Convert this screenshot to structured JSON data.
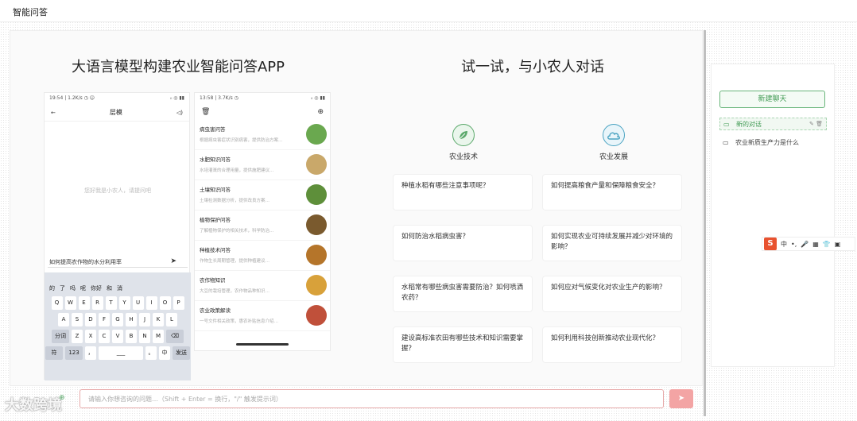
{
  "app": {
    "title": "智能问答"
  },
  "left_title": "大语言模型构建农业智能问答APP",
  "right_title": "试一试，与小农人对话",
  "phone1": {
    "status_time": "19:54 | 1.2K/s ◷ ☺",
    "status_right": "ᵢₗ ◎ ▮▮",
    "back_icon": "←",
    "title": "层模",
    "sound_icon": "◁)",
    "empty_text": "您好我是小农人，请提问吧",
    "input_value": "如何提高农作物的水分利用率",
    "send_icon": "➤",
    "candidates": [
      "的",
      "了",
      "吗",
      "呢",
      "你好",
      "和",
      "消"
    ],
    "keys_row1": [
      "Q",
      "W",
      "E",
      "R",
      "T",
      "Y",
      "U",
      "I",
      "O",
      "P"
    ],
    "keys_row2": [
      "A",
      "S",
      "D",
      "F",
      "G",
      "H",
      "J",
      "K",
      "L"
    ],
    "keys_row3": [
      "分词",
      "Z",
      "X",
      "C",
      "V",
      "B",
      "N",
      "M",
      "⌫"
    ],
    "keys_row4": [
      "符",
      "123",
      "，",
      "___",
      "。",
      "中",
      "发送"
    ]
  },
  "phone2": {
    "status_time": "13:58 | 3.7K/s ◷",
    "status_right": "ᵢₗ ◎ ▮▮",
    "trash_icon": "🗑",
    "add_icon": "⊕",
    "items": [
      {
        "title": "病虫害问答",
        "desc": "根据病虫害症状识别病害，提供防治方案…"
      },
      {
        "title": "水肥知识问答",
        "desc": "水培灌溉的合理用量，提供施肥建议…"
      },
      {
        "title": "土壤知识问答",
        "desc": "土壤检测数据分析，提供改良方案…"
      },
      {
        "title": "植物保护问答",
        "desc": "了解植物保护的相关技术，科学防治…"
      },
      {
        "title": "种植技术问答",
        "desc": "作物生长周期管理，提供种植建议…"
      },
      {
        "title": "农作物知识",
        "desc": "大豆的栽培管理，农作物品种知识…"
      },
      {
        "title": "农业政策解读",
        "desc": "一号文件相关政策，惠农补贴信息介绍…"
      }
    ]
  },
  "categories": [
    {
      "label": "农业技术",
      "icon": "leaf-icon"
    },
    {
      "label": "农业发展",
      "icon": "cloud-icon"
    }
  ],
  "questions": [
    "种植水稻有哪些注意事项呢？",
    "如何提高粮食产量和保障粮食安全？",
    "如何防治水稻病虫害？",
    "如何实现农业可持续发展并减少对环境的影响？",
    "水稻常有哪些病虫害需要防治？如何喷洒农药？",
    "如何应对气候变化对农业生产的影响？",
    "建设高标准农田有哪些技术和知识需要掌握？",
    "如何利用科技创新推动农业现代化？"
  ],
  "sidebar": {
    "new_chat": "新建聊天",
    "chats": [
      {
        "label": "新的对话",
        "active": true
      },
      {
        "label": "农业新质生产力是什么",
        "active": false
      }
    ]
  },
  "ime": {
    "logo": "S",
    "lang": "中"
  },
  "input": {
    "placeholder": "请输入你想咨询的问题…（Shift + Enter = 换行，\"/\" 触发提示词）"
  },
  "send_icon": "➤",
  "watermark": "大数跨境"
}
